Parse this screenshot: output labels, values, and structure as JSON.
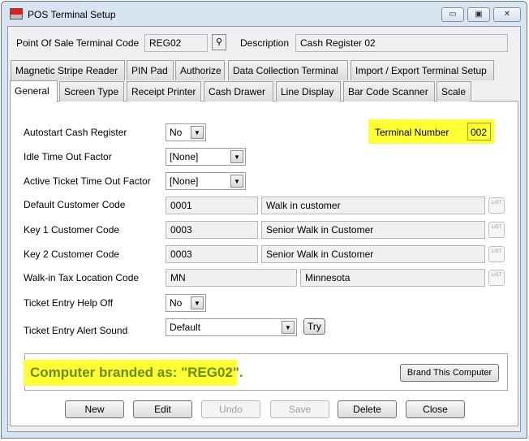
{
  "window": {
    "title": "POS Terminal Setup",
    "minimize": "▭",
    "maximize": "▣",
    "close": "✕"
  },
  "header": {
    "code_label": "Point Of Sale Terminal Code",
    "code_value": "REG02",
    "lookup_icon": "binoculars-icon",
    "description_label": "Description",
    "description_value": "Cash Register 02"
  },
  "tabs_row1": [
    "Magnetic Stripe Reader",
    "PIN Pad",
    "Authorize",
    "Data Collection Terminal",
    "Import / Export Terminal Setup"
  ],
  "tabs_row2": [
    "General",
    "Screen Type",
    "Receipt Printer",
    "Cash Drawer",
    "Line Display",
    "Bar Code Scanner",
    "Scale"
  ],
  "active_tab": "General",
  "form": {
    "autostart": {
      "label": "Autostart Cash Register",
      "value": "No"
    },
    "terminal_number": {
      "label": "Terminal Number",
      "value": "002"
    },
    "idle": {
      "label": "Idle Time Out Factor",
      "value": "[None]"
    },
    "active_ticket": {
      "label": "Active Ticket Time Out Factor",
      "value": "[None]"
    },
    "default_customer": {
      "label": "Default Customer Code",
      "code": "0001",
      "desc": "Walk in customer"
    },
    "key1": {
      "label": "Key 1 Customer Code",
      "code": "0003",
      "desc": "Senior Walk in Customer"
    },
    "key2": {
      "label": "Key 2 Customer Code",
      "code": "0003",
      "desc": "Senior Walk in Customer"
    },
    "tax": {
      "label": "Walk-in Tax Location Code",
      "code": "MN",
      "desc": "Minnesota"
    },
    "help_off": {
      "label": "Ticket Entry Help Off",
      "value": "No"
    },
    "alert": {
      "label": "Ticket Entry Alert Sound",
      "value": "Default",
      "try": "Try"
    },
    "list_label": "LIST"
  },
  "brand": {
    "message": "Computer branded as: \"REG02\".",
    "button": "Brand This Computer"
  },
  "buttons": {
    "new": "New",
    "edit": "Edit",
    "undo": "Undo",
    "save": "Save",
    "delete": "Delete",
    "close": "Close"
  },
  "colors": {
    "highlight": "#ffff33",
    "brand_text": "#6b8e00"
  }
}
